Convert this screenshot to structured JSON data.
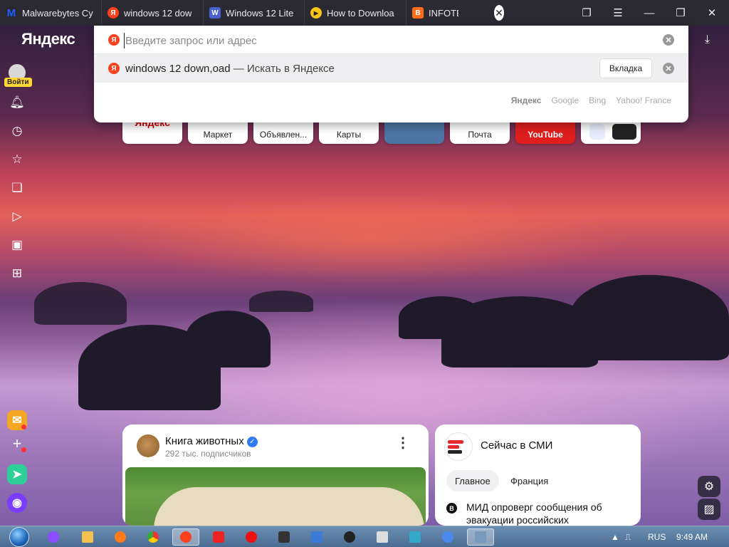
{
  "tabs": [
    {
      "title": "Malwarebytes Cy",
      "favicon": "malwarebytes-icon",
      "color": "#1a5cff"
    },
    {
      "title": "windows 12 dow",
      "favicon": "yandex-icon",
      "color": "#fc3f1d"
    },
    {
      "title": "Windows 12 Lite",
      "favicon": "site-icon",
      "color": "#4a5fd0"
    },
    {
      "title": "How to Downloa",
      "favicon": "play-icon",
      "color": "#f5c518"
    },
    {
      "title": "INFOTECH",
      "favicon": "blogger-icon",
      "color": "#ff6d1a"
    }
  ],
  "browser": {
    "logo": "Яндекс"
  },
  "omnibox": {
    "placeholder": "Введите запрос или адрес",
    "suggestion": "windows 12 down,oad",
    "suggestion_suffix": " — Искать в Яндексе",
    "tab_button": "Вкладка",
    "engines": [
      "Яндекс",
      "Google",
      "Bing",
      "Yahoo! France"
    ]
  },
  "sidebar": {
    "login": "Войти"
  },
  "tiles": [
    {
      "label": "Яндекс",
      "color": "#fff"
    },
    {
      "label": "Маркет",
      "color": "#fff"
    },
    {
      "label": "Объявлен...",
      "color": "#fff"
    },
    {
      "label": "Карты",
      "color": "#fff"
    },
    {
      "label": "",
      "color": "#4c75a3"
    },
    {
      "label": "Почта",
      "color": "#fff"
    },
    {
      "label": "YouTube",
      "color": "#e01e1e"
    }
  ],
  "card_animals": {
    "title": "Книга животных",
    "subscribers": "292 тыс. подписчиков"
  },
  "card_news": {
    "title": "Сейчас в СМИ",
    "tabs": [
      "Главное",
      "Франция"
    ],
    "headline_line1": "МИД опроверг сообщения об",
    "headline_line2": "эвакуации российских"
  },
  "taskbar": {
    "lang": "RUS",
    "time": "9:49 AM"
  }
}
